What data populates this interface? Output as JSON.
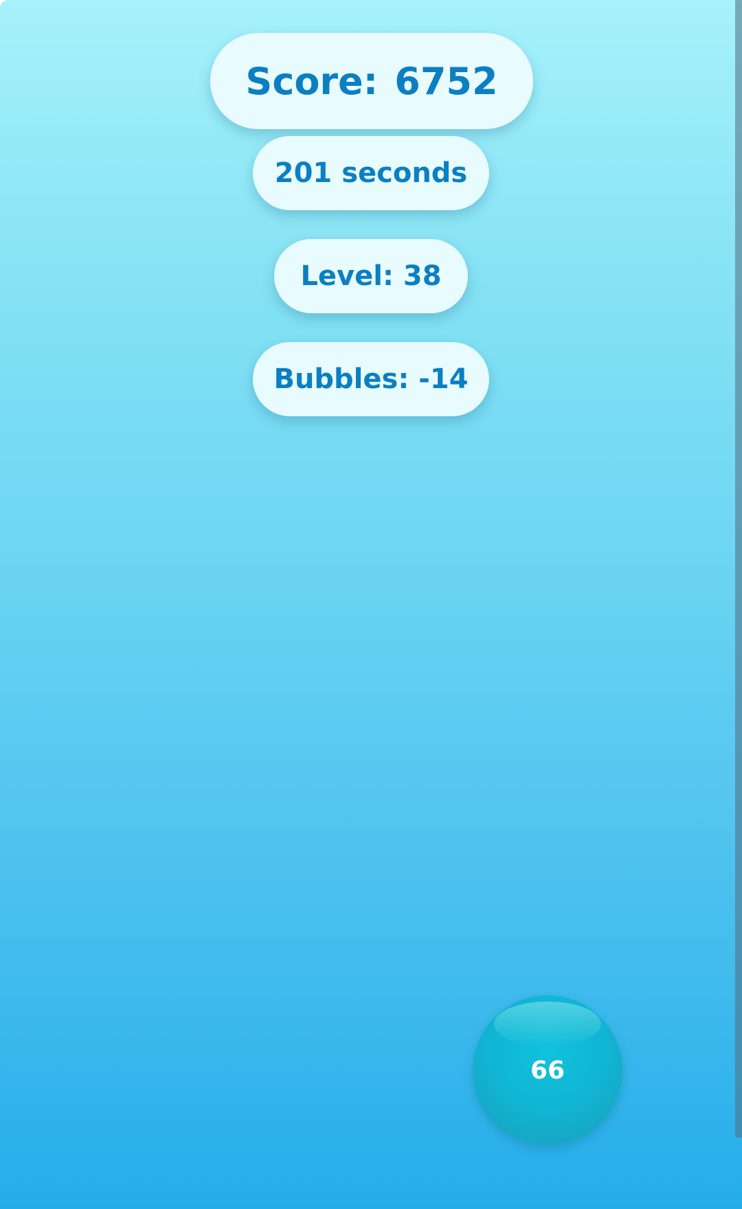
{
  "hud": {
    "score_label": "Score:",
    "score_value": "6752",
    "time_text": "201 seconds",
    "level_text": "Level: 38",
    "bubbles_text": "Bubbles: -14"
  },
  "bubbles": [
    {
      "value": "66"
    }
  ],
  "colors": {
    "pill_background": "#e8fbfe",
    "pill_text": "#0b7fc2",
    "background_top": "#a6f2fb",
    "background_bottom": "#25adea",
    "bubble": "#10b6d4"
  }
}
